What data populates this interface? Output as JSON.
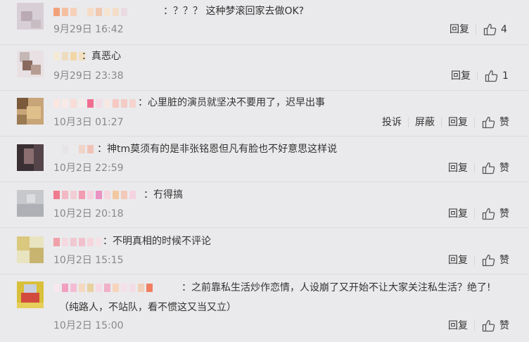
{
  "comments": [
    {
      "text": "：？？？ 这种梦滚回家去做OK?",
      "time": "9月29日 16:42",
      "actions": [
        "回复"
      ],
      "likes": "4"
    },
    {
      "text": "：真恶心",
      "time": "9月29日 23:38",
      "actions": [
        "回复"
      ],
      "likes": "1"
    },
    {
      "text": "：心里脏的演员就坚决不要用了，迟早出事",
      "time": "10月3日 01:27",
      "actions": [
        "投诉",
        "屏蔽",
        "回复"
      ],
      "likes": "赞"
    },
    {
      "text": "：神tm莫须有的是非张铭恩但凡有脸也不好意思这样说",
      "time": "10月2日 22:59",
      "actions": [
        "回复"
      ],
      "likes": "赞"
    },
    {
      "text": "：冇得搞",
      "time": "10月2日 20:18",
      "actions": [
        "回复"
      ],
      "likes": "赞"
    },
    {
      "text": "：不明真相的时候不评论",
      "time": "10月2日 15:15",
      "actions": [
        "回复"
      ],
      "likes": "赞"
    },
    {
      "text": "：之前靠私生活炒作恋情，人设崩了又开始不让大家关注私生活？绝了!",
      "text2": "（纯路人，不站队，看不惯这又当又立）",
      "time": "10月2日 15:00",
      "actions": [
        "回复"
      ],
      "likes": "赞"
    }
  ],
  "icons": {
    "like": "thumbs-up-icon"
  },
  "colors": {
    "background": "#eaeaec",
    "time": "#888888",
    "text": "#333333"
  }
}
